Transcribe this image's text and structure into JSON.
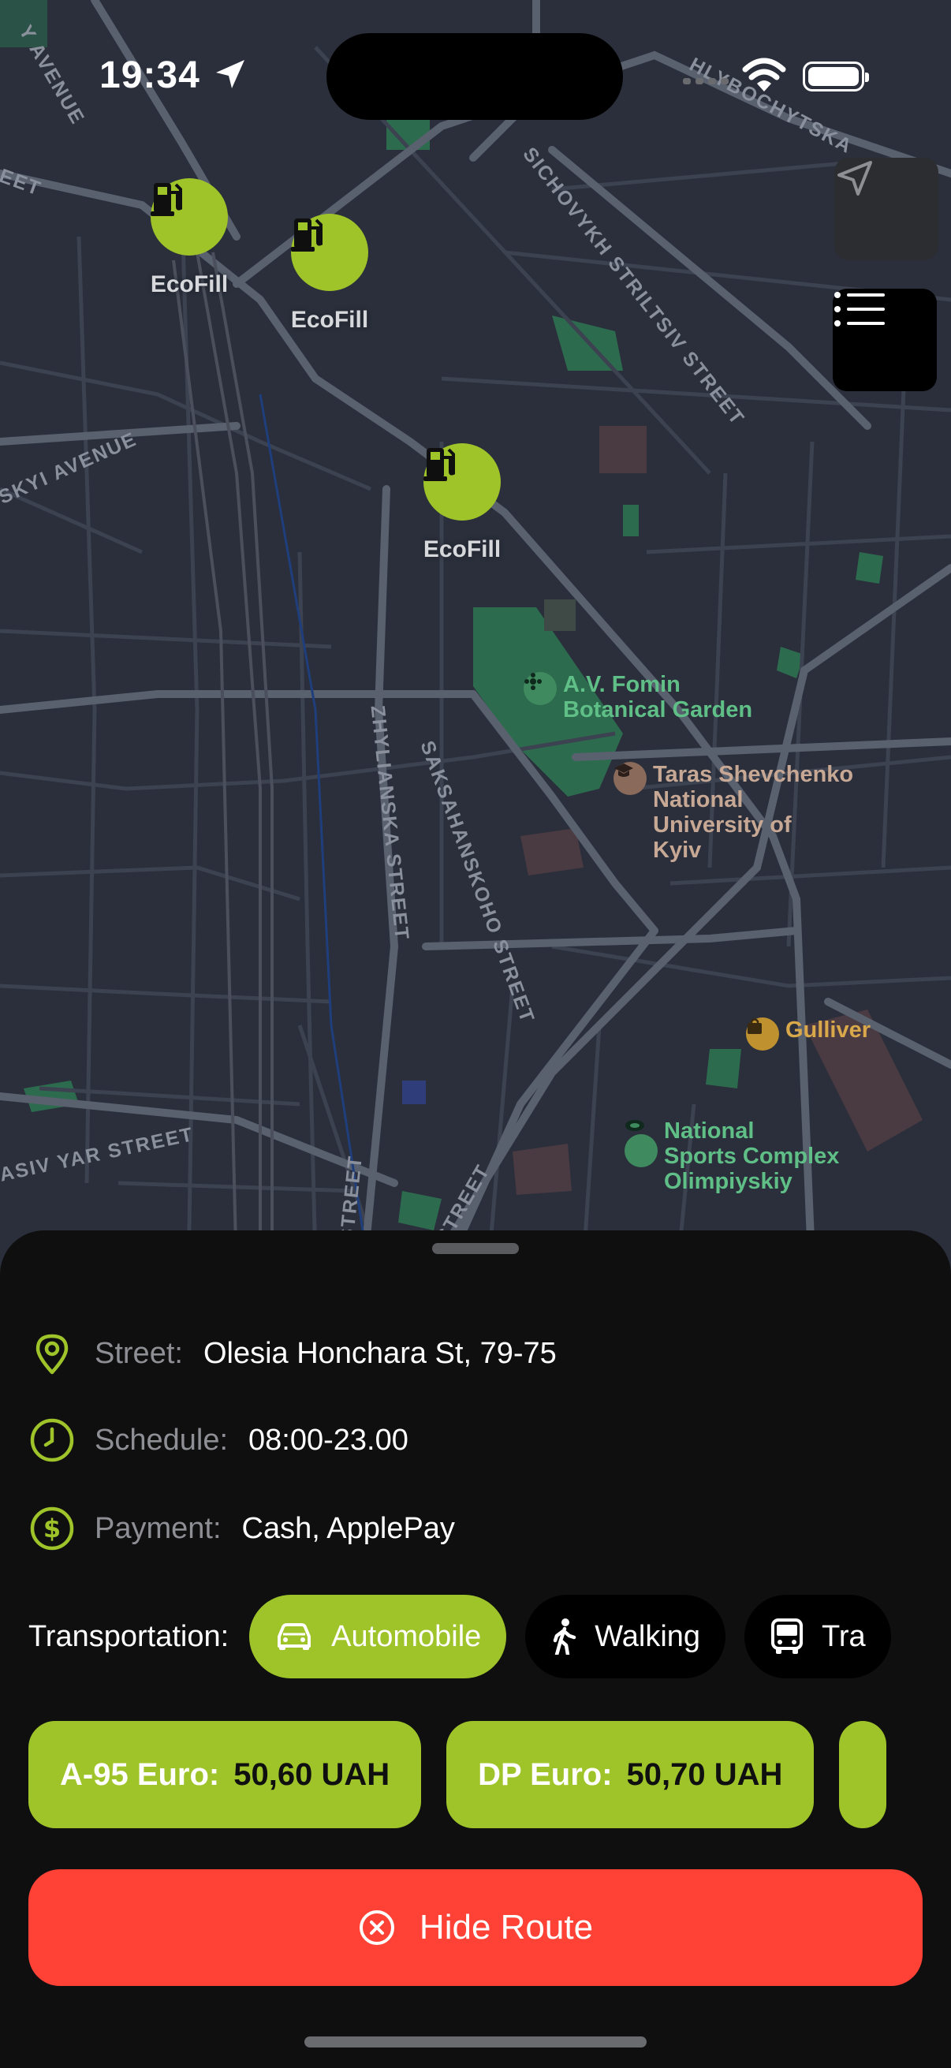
{
  "status_bar": {
    "time": "19:34"
  },
  "map": {
    "pins": [
      {
        "label": "EcoFill"
      },
      {
        "label": "EcoFill"
      },
      {
        "label": "EcoFill"
      }
    ],
    "streets": {
      "s1": "HLYBOCHYTSKA",
      "s2": "SICHOVYKH STRILTSIV STREET",
      "s3": "SKYI AVENUE",
      "s4": "Y AVENUE",
      "s5": "EET",
      "s6": "ZHYLIANSKA STREET",
      "s7": "SAKSAHANSKOHO STREET",
      "s8": "ASIV YAR STREET",
      "s9": "STREET",
      "s10": "STREET"
    },
    "pois": {
      "garden": "A.V. Fomin\nBotanical Garden",
      "university": "Taras Shevchenko\nNational\nUniversity of\nKyiv",
      "gulliver": "Gulliver",
      "sports": "National\nSports Complex\nOlimpiyskiy"
    },
    "colors": {
      "accent": "#9fc42a",
      "park": "#2d6b4f",
      "danger": "#ff4136"
    }
  },
  "details": {
    "street_label": "Street:",
    "street_value": "Olesia Honchara St, 79-75",
    "schedule_label": "Schedule:",
    "schedule_value": "08:00-23.00",
    "payment_label": "Payment:",
    "payment_value": "Cash, ApplePay"
  },
  "transport": {
    "label": "Transportation:",
    "options": [
      {
        "label": "Automobile",
        "icon": "car-icon",
        "selected": true
      },
      {
        "label": "Walking",
        "icon": "walking-icon",
        "selected": false
      },
      {
        "label": "Tra",
        "icon": "bus-icon",
        "selected": false
      }
    ]
  },
  "fuel": [
    {
      "name": "A-95 Euro:",
      "price": "50,60 UAH"
    },
    {
      "name": "DP Euro:",
      "price": "50,70 UAH"
    }
  ],
  "actions": {
    "hide_route": "Hide Route"
  }
}
